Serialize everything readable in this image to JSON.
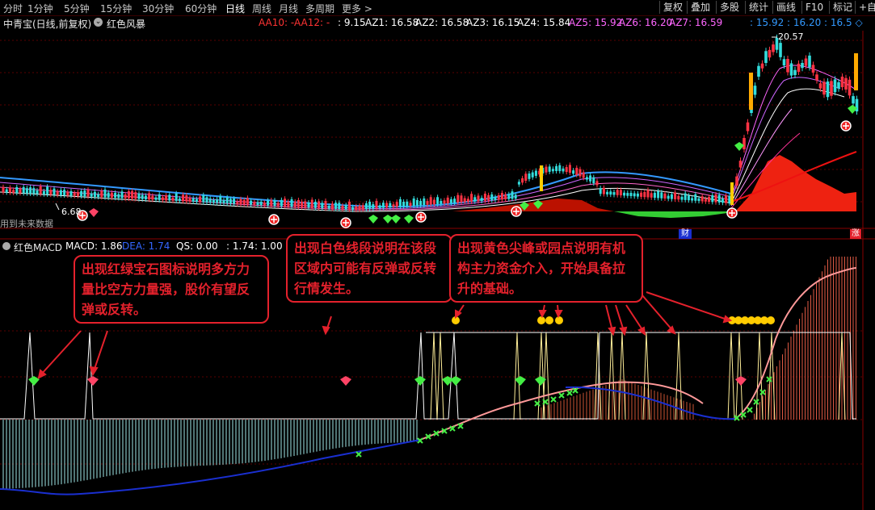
{
  "toolbar": {
    "periods": [
      "分时",
      "1分钟",
      "5分钟",
      "15分钟",
      "30分钟",
      "60分钟",
      "日线",
      "周线",
      "月线",
      "多周期",
      "更多 >"
    ],
    "active_period": "日线",
    "right_buttons": [
      "复权",
      "叠加",
      "多股",
      "统计",
      "画线",
      "F10",
      "标记",
      "+自"
    ]
  },
  "stock": {
    "title": "中青宝(日线,前复权)",
    "indicator_toggle": "⌄",
    "indicator_name": "红色风暴"
  },
  "ma_readout": {
    "aa10": "AA10: -",
    "aa12": "AA12: -",
    "v1": ": 9.15",
    "az1": "AZ1: 16.58",
    "az2": "AZ2: 16.58",
    "az3": "AZ3: 16.15",
    "az4": "AZ4: 15.84",
    "az5": "AZ5: 15.92",
    "az6": "AZ6: 16.20",
    "az7": "AZ7: 16.59",
    "extra": ": 15.92 : 16.20 : 16.5 ◇"
  },
  "price_labels": {
    "high": "20.57",
    "low": "6.68",
    "future": "用到未来数据"
  },
  "markers": {
    "cai": "财",
    "zhang": "涨"
  },
  "macd_readout": {
    "name": "红色MACD",
    "macd": "MACD: 1.86",
    "dea": "DEA: 1.74",
    "qs": "QS: 0.00",
    "v1": ": 1.74",
    "v2": ": 1.00"
  },
  "callouts": {
    "gem": "出现红绿宝石图标说明多方力量比空方力量强，股价有望反弹或反转。",
    "white": "出现白色线段说明在该段区域内可能有反弹或反转行情发生。",
    "yellow": "出现黄色尖峰或园点说明有机构主力资金介入，开始具备拉升的基础。"
  },
  "colors": {
    "up": "#ff3344",
    "down": "#33dddd",
    "accent_red": "#e4212c",
    "yellow": "#ffcc00",
    "green": "#44ee44",
    "blue": "#1a2fd0"
  }
}
